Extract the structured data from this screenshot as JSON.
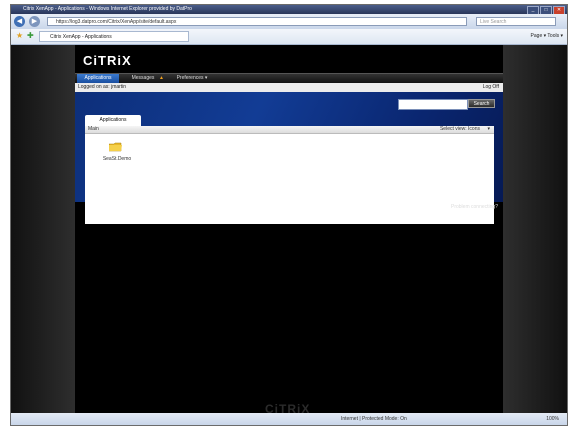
{
  "window": {
    "title": "Citrix XenApp - Applications - Windows Internet Explorer provided by DatPro",
    "controls": [
      "_",
      "□",
      "✕"
    ]
  },
  "browser": {
    "url": "https://log3.datpro.com/Citrix/XenApp/site/default.aspx",
    "search_placeholder": "Live Search",
    "tab_title": "Citrix XenApp - Applications",
    "tools": "Page ▾  Tools ▾"
  },
  "app": {
    "logo": "CiTRiX",
    "nav_tabs": [
      {
        "label": "Applications"
      },
      {
        "label": "Messages"
      },
      {
        "label": "Preferences ▾"
      }
    ],
    "logged_on": "Logged on as: jmartin",
    "logoff": "Log Off",
    "search_button": "Search",
    "apps_tab": "Applications",
    "breadcrumb": "Main",
    "view_label": "Select view:  Icons",
    "apps": [
      {
        "label": "SeaSt.Demo"
      }
    ],
    "problem_link": "Problem connecting?",
    "footer_logo": "CiTRiX"
  },
  "status": {
    "zone": "Internet | Protected Mode: On",
    "zoom": "100%"
  },
  "colors": {
    "accent": "#1a4fa0",
    "banner": "#123c95"
  }
}
